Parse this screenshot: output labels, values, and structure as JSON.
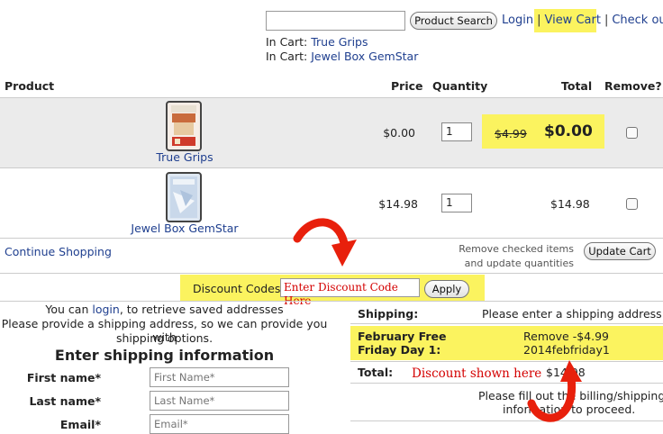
{
  "header": {
    "search_placeholder": "",
    "search_button": "Product Search",
    "links": [
      "Login",
      "View Cart",
      "Check out"
    ],
    "separator": "|",
    "in_cart_prefix": "In Cart:",
    "in_cart_items": [
      "True Grips",
      "Jewel Box GemStar"
    ]
  },
  "table": {
    "headers": [
      "Product",
      "Price",
      "Quantity",
      "Total",
      "Remove?"
    ],
    "rows": [
      {
        "name": "True Grips",
        "price": "$0.00",
        "qty": "1",
        "total_old": "$4.99",
        "total": "$0.00"
      },
      {
        "name": "Jewel Box GemStar",
        "price": "$14.98",
        "qty": "1",
        "total": "$14.98"
      }
    ]
  },
  "cart_actions": {
    "continue": "Continue Shopping",
    "remove_note_1": "Remove checked items",
    "remove_note_2": "and update quantities",
    "update_button": "Update Cart"
  },
  "discount": {
    "label": "Discount Codes:",
    "input_value": "Enter Discount Code Here",
    "apply_button": "Apply"
  },
  "shipping_form": {
    "line1_pre": "You can ",
    "line1_link": "login",
    "line1_post": ", to retrieve saved addresses",
    "line2": "Please provide a shipping address, so we can provide you with",
    "line3": "shipping options.",
    "heading": "Enter shipping information",
    "fields": [
      {
        "label": "First name*",
        "placeholder": "First Name*"
      },
      {
        "label": "Last name*",
        "placeholder": "Last Name*"
      },
      {
        "label": "Email*",
        "placeholder": "Email*"
      }
    ]
  },
  "summary": {
    "shipping_label": "Shipping:",
    "shipping_value": "Please enter a shipping address",
    "promo_label_1": "February Free",
    "promo_label_2": "Friday Day 1:",
    "promo_value_1": "Remove -$4.99",
    "promo_value_2": "2014febfriday1",
    "total_label": "Total:",
    "total_value": "$14.98",
    "note_1": "Please fill out the billing/shipping",
    "note_2": "information to proceed."
  },
  "annotations": {
    "discount_shown": "Discount shown here"
  },
  "colors": {
    "highlight": "#fbf35f",
    "link": "#1f3f8f",
    "annotation_red": "#e8200c"
  }
}
